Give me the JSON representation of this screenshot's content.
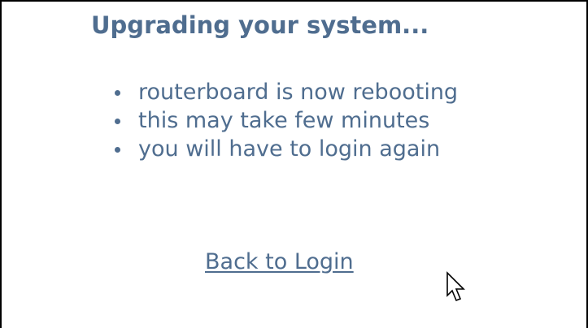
{
  "page": {
    "title": "Upgrading your system..."
  },
  "status": {
    "items": [
      "routerboard is now rebooting",
      "this may take few minutes",
      "you will have to login again"
    ]
  },
  "actions": {
    "back_to_login": "Back to Login"
  },
  "colors": {
    "text": "#4f6d8f",
    "background": "#ffffff",
    "border": "#000000"
  },
  "icons": {
    "pointer": "mouse-pointer-icon"
  }
}
